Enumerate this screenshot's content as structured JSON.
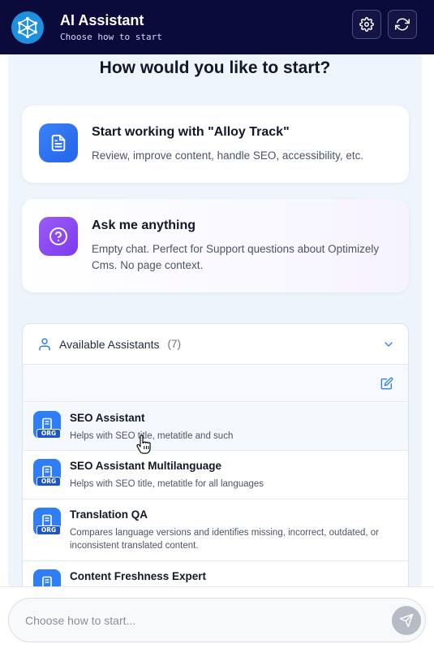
{
  "header": {
    "title": "AI Assistant",
    "subtitle": "Choose how to start",
    "logo_icon": "neural-network-icon",
    "settings_icon": "gear-icon",
    "refresh_icon": "refresh-icon"
  },
  "main": {
    "heading": "How would you like to start?",
    "cards": [
      {
        "title": "Start working with \"Alloy Track\"",
        "description": "Review, improve content, handle SEO, accessibility, etc.",
        "icon": "document-icon"
      },
      {
        "title": "Ask me anything",
        "description": "Empty chat. Perfect for Support questions about Optimizely Cms. No page context.",
        "icon": "question-icon"
      }
    ]
  },
  "assistants": {
    "label": "Available Assistants",
    "count": "(7)",
    "edit_icon": "edit-icon",
    "badge_label": "ORG",
    "items": [
      {
        "name": "SEO Assistant",
        "description": "Helps with SEO title, metatitle and such"
      },
      {
        "name": "SEO Assistant Multilanguage",
        "description": "Helps with SEO title, metatitle for all languages"
      },
      {
        "name": "Translation QA",
        "description": "Compares language versions and identifies missing, incorrect, outdated, or inconsistent translated content."
      },
      {
        "name": "Content Freshness Expert",
        "description": ""
      }
    ]
  },
  "chat_input": {
    "placeholder": "Choose how to start...",
    "send_icon": "send-icon"
  },
  "colors": {
    "header_bg": "#0b0b3b",
    "accent_blue": "#2f7ef6",
    "accent_purple": "#7c3aed",
    "panel_bg": "#eef5fc"
  }
}
